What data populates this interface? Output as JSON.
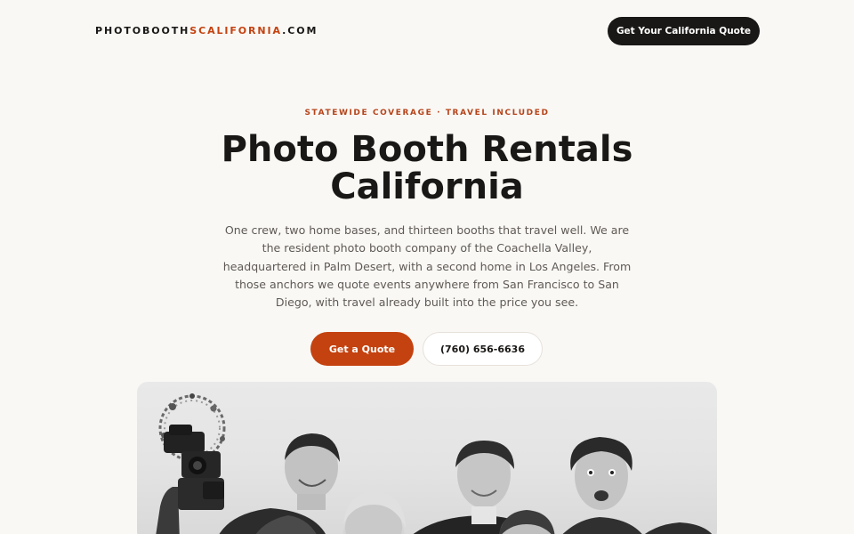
{
  "header": {
    "logo_part1": "PHOTOBOOTH",
    "logo_part2": "SCALIFORNIA",
    "logo_part3": ".COM",
    "cta_label": "Get Your California Quote"
  },
  "hero": {
    "eyebrow": "STATEWIDE COVERAGE · TRAVEL INCLUDED",
    "title": "Photo Booth Rentals California",
    "lede": "One crew, two home bases, and thirteen booths that travel well. We are the resident photo booth company of the Coachella Valley, headquartered in Palm Desert, with a second home in Los Angeles. From those anchors we quote events anywhere from San Francisco to San Diego, with travel already built into the price you see.",
    "primary_cta": "Get a Quote",
    "phone_cta": "(760) 656-6636"
  },
  "colors": {
    "background": "#faf8f5",
    "accent": "#c4420f",
    "dark": "#1a1816"
  }
}
